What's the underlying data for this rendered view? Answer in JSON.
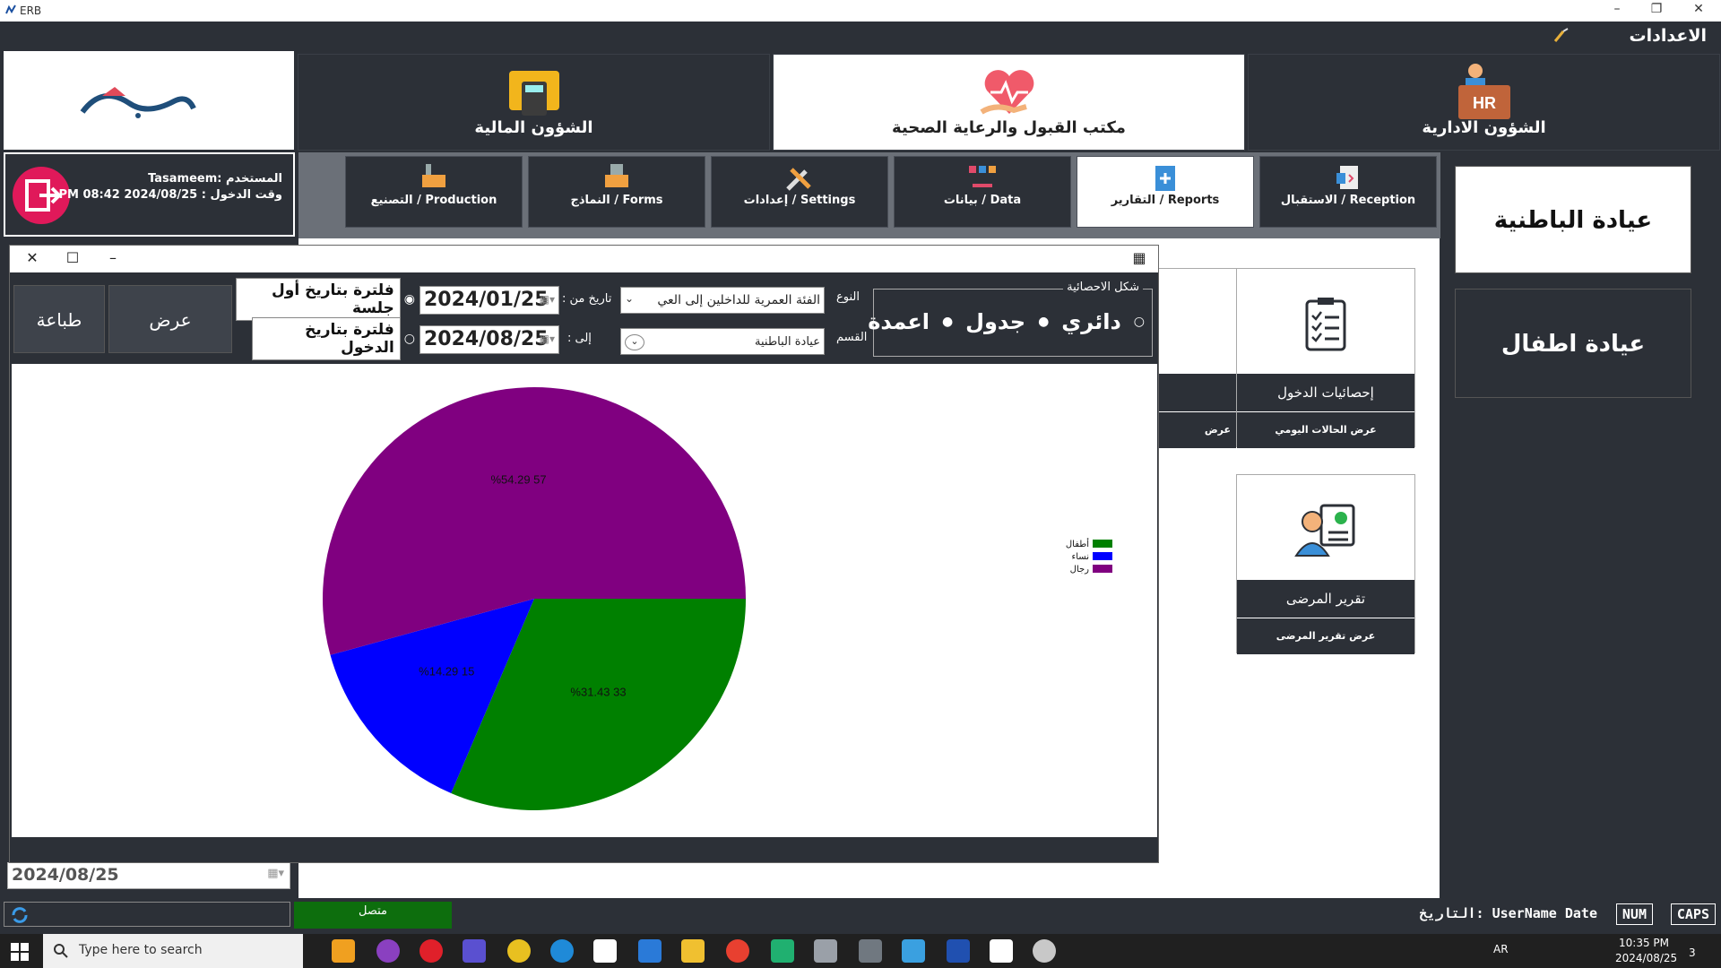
{
  "titlebar": {
    "app_name": "ERB",
    "minimize": "–",
    "restore": "❐",
    "close": "✕"
  },
  "settings": {
    "label": "الاعدادات"
  },
  "modules": [
    {
      "label": "الشؤون المالية",
      "icon": "calculator-folder-icon"
    },
    {
      "label": "مكتب القبول والرعاية الصحية",
      "icon": "heart-care-icon"
    },
    {
      "label": "الشؤون الادارية",
      "icon": "hr-icon"
    }
  ],
  "user": {
    "name_line": "المستخدم :Tasameem",
    "login_line": "وقت الدخول : 2024/08/25 PM 08:42"
  },
  "subtabs": [
    {
      "label": "Production / التصنيع"
    },
    {
      "label": "Forms / النماذج"
    },
    {
      "label": "Settings / إعدادات"
    },
    {
      "label": "Data / بيانات"
    },
    {
      "label": "Reports / التقارير"
    },
    {
      "label": "Reception / الاستقبال"
    }
  ],
  "clinics": [
    {
      "label": "عيادة الباطنية"
    },
    {
      "label": "عيادة اطفال"
    }
  ],
  "cards": [
    {
      "title": "إحصائيات الدخول",
      "footer": "عرض الحالات اليومي"
    },
    {
      "title": "تقرير المرضى",
      "footer": "عرض تقرير المرضى"
    },
    {
      "footer": "عرض"
    }
  ],
  "bottom_date": "2024/08/25",
  "status": {
    "connected": "متصل",
    "fields": "UserName Date :التاريخ",
    "num": "NUM",
    "caps": "CAPS"
  },
  "taskbar": {
    "search_placeholder": "Type here to search",
    "lang": "AR",
    "time": "10:35 PM",
    "date": "2024/08/25",
    "notif_count": "3"
  },
  "dialog": {
    "chart_type_title": "شكل الاحصائية",
    "chart_types": [
      "دائري",
      "جدول",
      "اعمدة"
    ],
    "type_label": "النوع",
    "type_value": "الفئة العمرية للداخلين إلى العي",
    "section_label": "القسم",
    "section_value": "عيادة الباطنية",
    "date_from_label": "تاريخ من :",
    "date_to_label": "إلى :",
    "date_from": "2024/01/25",
    "date_to": "2024/08/25",
    "filter_first": "فلترة بتاريخ أول جلسة",
    "filter_entry": "فلترة بتاريخ الدخول",
    "show_button": "عرض",
    "print_button": "طباعة"
  },
  "chart_data": {
    "type": "pie",
    "categories": [
      "أطفال",
      "نساء",
      "رجال"
    ],
    "values": [
      33,
      15,
      57
    ],
    "percent_labels": [
      "%31.43  33",
      "%14.29  15",
      "%54.29  57"
    ],
    "colors": [
      "#008000",
      "#0000ff",
      "#800080"
    ],
    "legend_position": "right"
  }
}
